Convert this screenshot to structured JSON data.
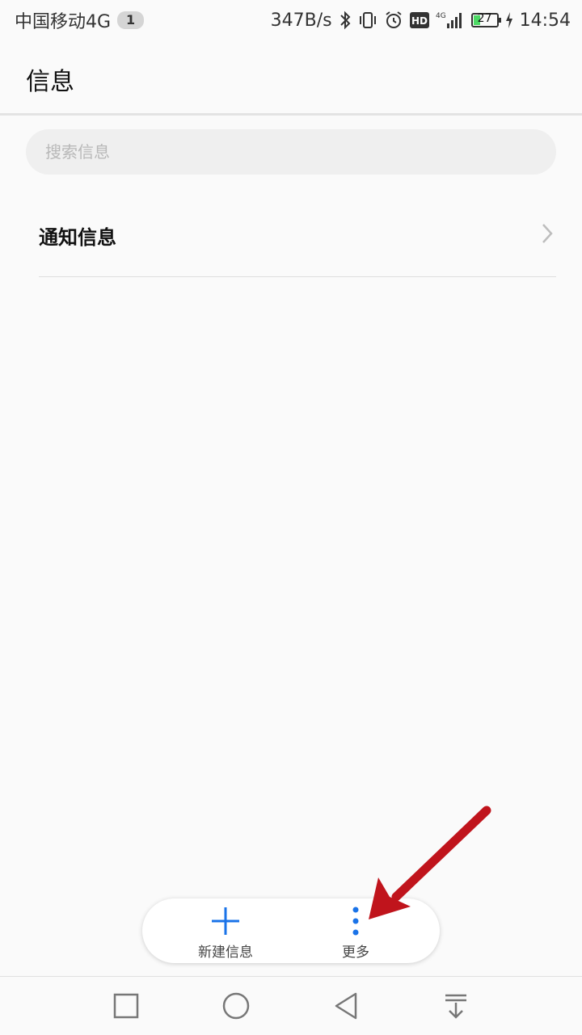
{
  "status_bar": {
    "carrier": "中国移动4G",
    "badge": "1",
    "net_speed": "347B/s",
    "battery": "27",
    "battery_level": 0.27,
    "time": "14:54",
    "icons": [
      "bluetooth-icon",
      "vibrate-icon",
      "alarm-icon",
      "hd-icon",
      "signal-icon",
      "battery-icon",
      "charging-icon"
    ]
  },
  "header": {
    "title": "信息"
  },
  "search": {
    "placeholder": "搜索信息"
  },
  "list": {
    "items": [
      {
        "label": "通知信息"
      }
    ]
  },
  "action_bar": {
    "new_label": "新建信息",
    "more_label": "更多"
  },
  "colors": {
    "accent": "#1a73e8",
    "annotation_arrow": "#c0141c"
  }
}
